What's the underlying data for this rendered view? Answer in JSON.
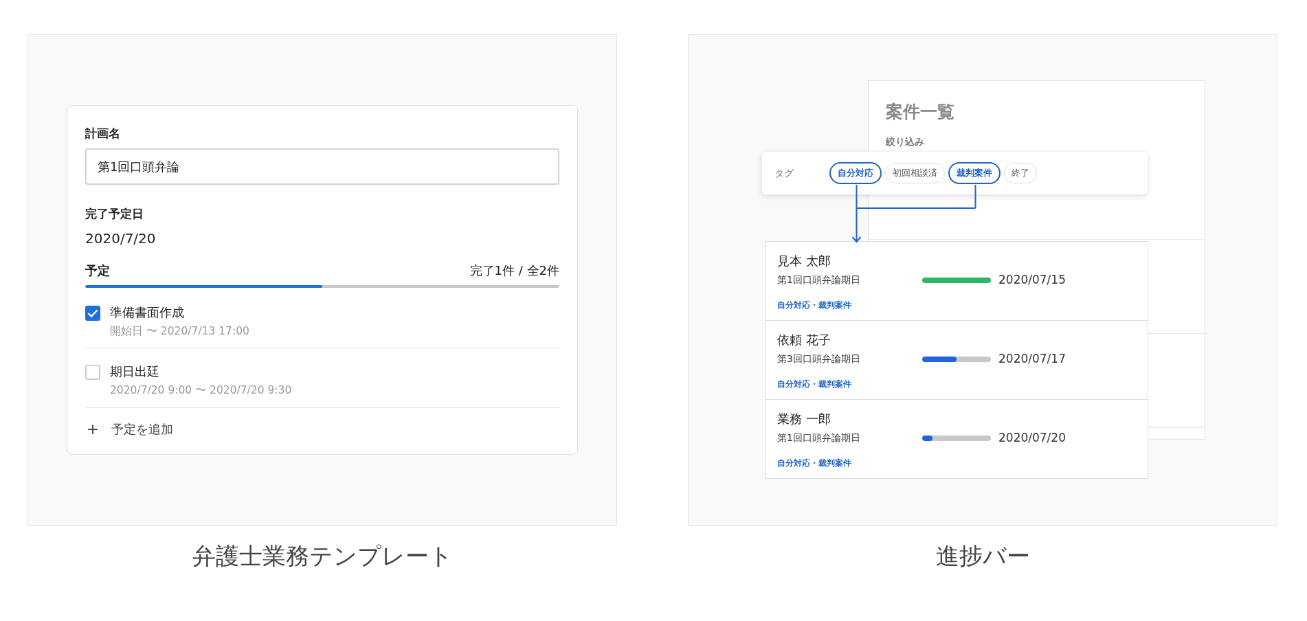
{
  "template_panel": {
    "plan_name_label": "計画名",
    "plan_name_value": "第1回口頭弁論",
    "due_label": "完了予定日",
    "due_value": "2020/7/20",
    "schedule_label": "予定",
    "schedule_count": "完了1件 / 全2件",
    "schedule_progress": {
      "level": 0.5
    },
    "items": [
      {
        "title": "準備書面作成",
        "period": "開始日 〜 2020/7/13 17:00",
        "checked": true
      },
      {
        "title": "期日出廷",
        "period": "2020/7/20 9:00 〜 2020/7/20 9:30",
        "checked": false
      }
    ],
    "add_icon": "+",
    "add_label": "予定を追加",
    "caption": "弁護士業務テンプレート"
  },
  "progress_panel": {
    "list_title": "案件一覧",
    "filter_label": "絞り込み",
    "tag_label": "タグ",
    "tags": [
      {
        "label": "自分対応",
        "selected": true
      },
      {
        "label": "初回相談済",
        "selected": false
      },
      {
        "label": "裁判案件",
        "selected": true
      },
      {
        "label": "終了",
        "selected": false
      }
    ],
    "cases": [
      {
        "name": "見本 太郎",
        "event": "第1回口頭弁論期日",
        "level": 1.0,
        "date": "2020/07/15",
        "tags": "自分対応・裁判案件"
      },
      {
        "name": "依頼 花子",
        "event": "第3回口頭弁論期日",
        "level": 0.5,
        "date": "2020/07/17",
        "tags": "自分対応・裁判案件"
      },
      {
        "name": "業務 一郎",
        "event": "第1回口頭弁論期日",
        "level": 0.15,
        "date": "2020/07/20",
        "tags": "自分対応・裁判案件"
      }
    ],
    "caption": "進捗バー"
  }
}
